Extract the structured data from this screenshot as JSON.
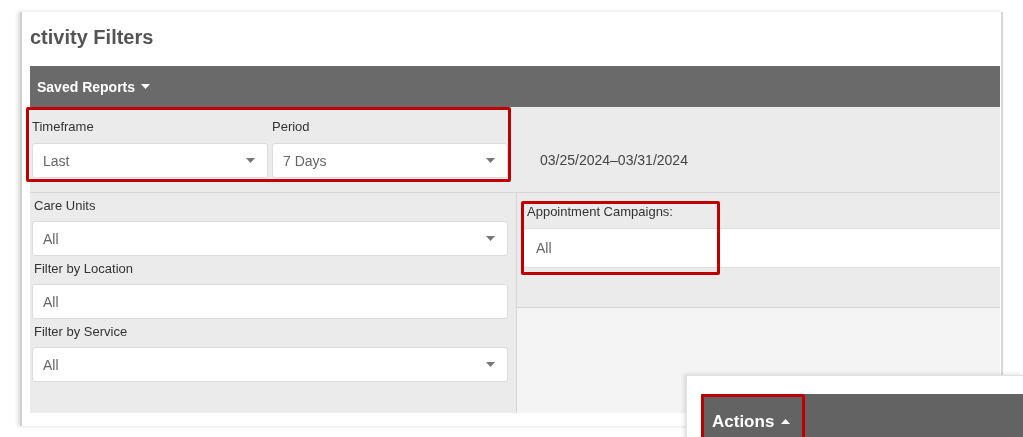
{
  "page": {
    "title": "ctivity Filters"
  },
  "toolbar": {
    "saved_reports": {
      "label": "Saved Reports",
      "expanded": false
    }
  },
  "date_range": {
    "highlighted": true,
    "range": "03/25/2024–03/31/2024",
    "fields": [
      {
        "label": "Timeframe",
        "value": "Last",
        "kind": "dropdown"
      },
      {
        "label": "Period",
        "value": "7 Days",
        "kind": "dropdown"
      }
    ]
  },
  "filters": [
    {
      "label": "Care Units",
      "value": "All",
      "kind": "dropdown"
    },
    {
      "label": "Filter by Location",
      "value": "All",
      "kind": "text"
    },
    {
      "label": "Filter by Service",
      "value": "All",
      "kind": "dropdown"
    }
  ],
  "campaigns": {
    "label": "Appointment Campaigns:",
    "value": "All",
    "highlighted": true
  },
  "actions": {
    "label": "Actions",
    "expanded": true,
    "highlighted": true
  }
}
